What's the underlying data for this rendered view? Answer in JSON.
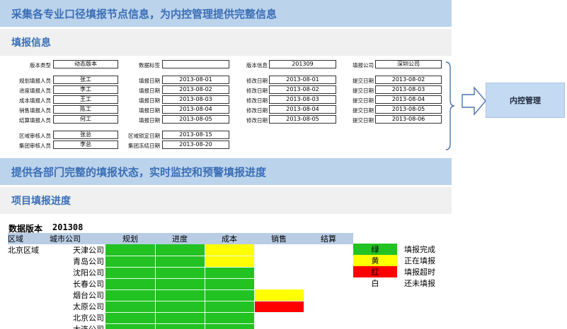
{
  "headers": {
    "main": "采集各专业口径填报节点信息，为内控管理提供完整信息",
    "section1": "填报信息",
    "main2": "提供各部门完整的填报状态，实时监控和预警填报进度",
    "section2": "项目填报进度"
  },
  "form": {
    "top": [
      {
        "label": "版本类型",
        "value": "动态版本"
      },
      {
        "label": "数据标签",
        "value": ""
      },
      {
        "label": "版本信息",
        "value": "201309"
      },
      {
        "label": "填报公司",
        "value": "深圳公司"
      }
    ],
    "rows": [
      {
        "person_label": "规划填报人员",
        "person": "张工",
        "date_label": "填报日期",
        "date": "2013-08-01",
        "mod_label": "修改日期",
        "mod": "2013-08-01",
        "sub_label": "提交日期",
        "sub": "2013-08-02"
      },
      {
        "person_label": "进度填报人员",
        "person": "李工",
        "date_label": "填报日期",
        "date": "2013-08-02",
        "mod_label": "修改日期",
        "mod": "2013-08-02",
        "sub_label": "提交日期",
        "sub": "2013-08-03"
      },
      {
        "person_label": "成本填报人员",
        "person": "王工",
        "date_label": "填报日期",
        "date": "2013-08-03",
        "mod_label": "修改日期",
        "mod": "2013-08-03",
        "sub_label": "提交日期",
        "sub": "2013-08-04"
      },
      {
        "person_label": "销售填报人员",
        "person": "陈工",
        "date_label": "填报日期",
        "date": "2013-08-04",
        "mod_label": "修改日期",
        "mod": "2013-08-04",
        "sub_label": "提交日期",
        "sub": "2013-08-05"
      },
      {
        "person_label": "结算填报人员",
        "person": "何工",
        "date_label": "填报日期",
        "date": "2013-08-05",
        "mod_label": "修改日期",
        "mod": "2013-08-05",
        "sub_label": "提交日期",
        "sub": "2013-08-06"
      }
    ],
    "audit": [
      {
        "person_label": "区域审核人员",
        "person": "张总",
        "date_label": "区域锁定日期",
        "date": "2013-08-15"
      },
      {
        "person_label": "集团审核人员",
        "person": "李总",
        "date_label": "集团冻结日期",
        "date": "2013-08-20"
      }
    ]
  },
  "control_box": "内控管理",
  "progress": {
    "version_label": "数据版本",
    "version": "201308",
    "headers": [
      "区域",
      "城市公司",
      "规划",
      "进度",
      "成本",
      "销售",
      "结算"
    ],
    "region": "北京区域",
    "rows": [
      {
        "city": "天津公司",
        "status": [
          "g",
          "g",
          "y",
          "w",
          "w"
        ]
      },
      {
        "city": "青岛公司",
        "status": [
          "g",
          "g",
          "y",
          "w",
          "w"
        ]
      },
      {
        "city": "沈阳公司",
        "status": [
          "g",
          "g",
          "g",
          "w",
          "w"
        ]
      },
      {
        "city": "长春公司",
        "status": [
          "g",
          "g",
          "g",
          "w",
          "w"
        ]
      },
      {
        "city": "烟台公司",
        "status": [
          "g",
          "g",
          "g",
          "y",
          "w"
        ]
      },
      {
        "city": "太原公司",
        "status": [
          "g",
          "g",
          "g",
          "r",
          "w"
        ]
      },
      {
        "city": "北京公司",
        "status": [
          "g",
          "g",
          "g",
          "w",
          "w"
        ]
      },
      {
        "city": "大连公司",
        "status": [
          "g",
          "g",
          "g",
          "w",
          "w"
        ]
      }
    ]
  },
  "legend": [
    {
      "swatch": "绿",
      "text": "填报完成",
      "color": "#22c222"
    },
    {
      "swatch": "黄",
      "text": "正在填报",
      "color": "#ffff00"
    },
    {
      "swatch": "红",
      "text": "填报超时",
      "color": "#ff0000"
    },
    {
      "swatch": "白",
      "text": "还未填报",
      "color": "#ffffff"
    }
  ]
}
